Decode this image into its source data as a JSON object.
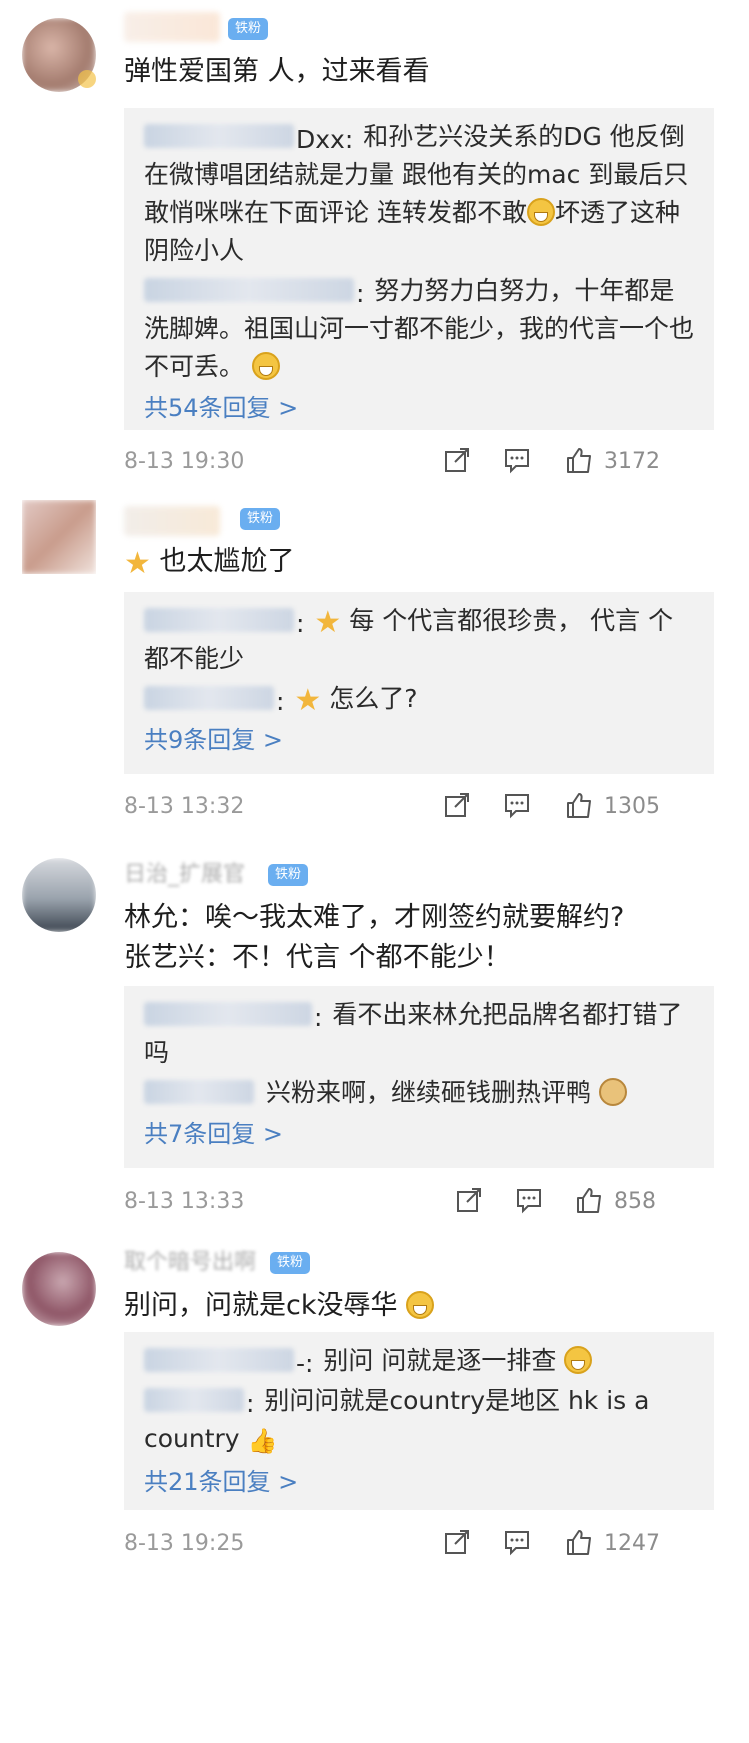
{
  "comments": [
    {
      "badge": "铁粉",
      "text": "弹性爱国第 人，过来看看",
      "replies": [
        {
          "name_suffix": "Dxx:",
          "text": "和孙艺兴没关系的DG  他反倒在微博唱团结就是力量  跟他有关的mac 到最后只敢悄咪咪在下面评论 连转发都不敢",
          "text2": "坏透了这种阴险小人"
        },
        {
          "name_suffix": ":",
          "text": "努力努力白努力，十年都是洗脚婢。祖国山河一寸都不能少，我的代言一个也不可丢。"
        }
      ],
      "more": "共54条回复 >",
      "time": "8-13 19:30",
      "likes": "3172"
    },
    {
      "badge": "铁粉",
      "text": "也太尴尬了",
      "replies": [
        {
          "name_suffix": ":",
          "text": "每 个代言都很珍贵，  代言 个都不能少"
        },
        {
          "name_suffix": ":",
          "text": "怎么了?"
        }
      ],
      "more": "共9条回复 >",
      "time": "8-13 13:32",
      "likes": "1305"
    },
    {
      "badge": "铁粉",
      "name_visible": "日治_扩展官",
      "text": "林允：唉～我太难了，才刚签约就要解约?",
      "text2": "张艺兴：不！代言 个都不能少！",
      "replies": [
        {
          "name_suffix": ":",
          "text": "看不出来林允把品牌名都打错了吗"
        },
        {
          "name_suffix": "",
          "text": "兴粉来啊，继续砸钱删热评鸭"
        }
      ],
      "more": "共7条回复 >",
      "time": "8-13 13:33",
      "likes": "858"
    },
    {
      "badge": "铁粉",
      "name_visible": "取个暗号出啊",
      "text": "别问，问就是ck没辱华",
      "replies": [
        {
          "name_suffix": "-:",
          "text": "别问 问就是逐一排查"
        },
        {
          "name_suffix": ":",
          "text": "别问问就是country是地区 hk is a country"
        }
      ],
      "more": "共21条回复 >",
      "time": "8-13 19:25",
      "likes": "1247"
    }
  ],
  "icons": {
    "share": "share-icon",
    "comment": "comment-icon",
    "like": "like-icon"
  },
  "colors": {
    "link": "#4a7fc1",
    "badge": "#6aaef0",
    "reply_bg": "#f2f2f2",
    "meta": "#9a9a9a"
  }
}
